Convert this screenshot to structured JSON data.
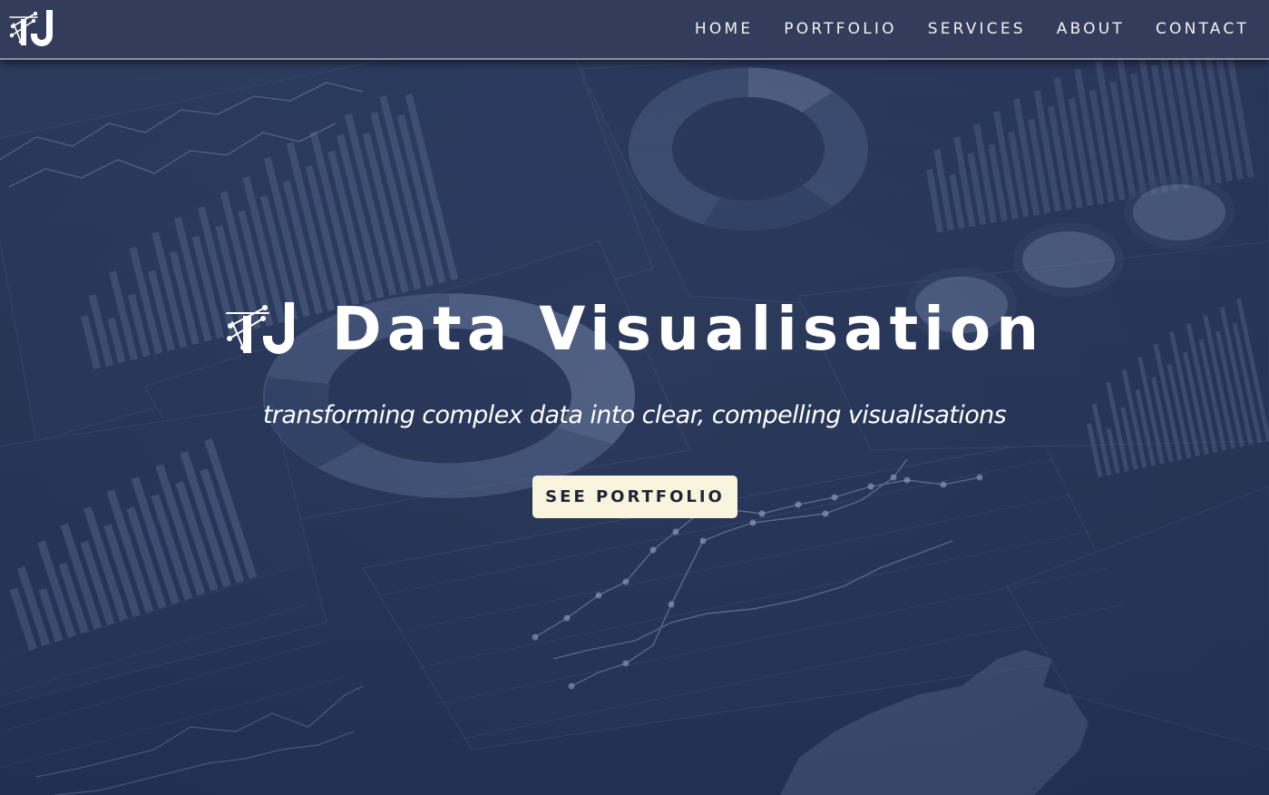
{
  "nav": {
    "logo_icon": "tj-logo-icon",
    "links": [
      {
        "label": "HOME"
      },
      {
        "label": "PORTFOLIO"
      },
      {
        "label": "SERVICES"
      },
      {
        "label": "ABOUT"
      },
      {
        "label": "CONTACT"
      }
    ]
  },
  "hero": {
    "title": "Data Visualisation",
    "subtitle": "transforming complex data into clear, compelling visualisations",
    "button_label": "SEE PORTFOLIO",
    "background_icon": "dashboard-charts-background"
  },
  "colors": {
    "nav_bg": "#333c5a",
    "hero_bg": "#2d3c5d",
    "button_bg": "#f8f4dd",
    "text": "#ffffff"
  }
}
